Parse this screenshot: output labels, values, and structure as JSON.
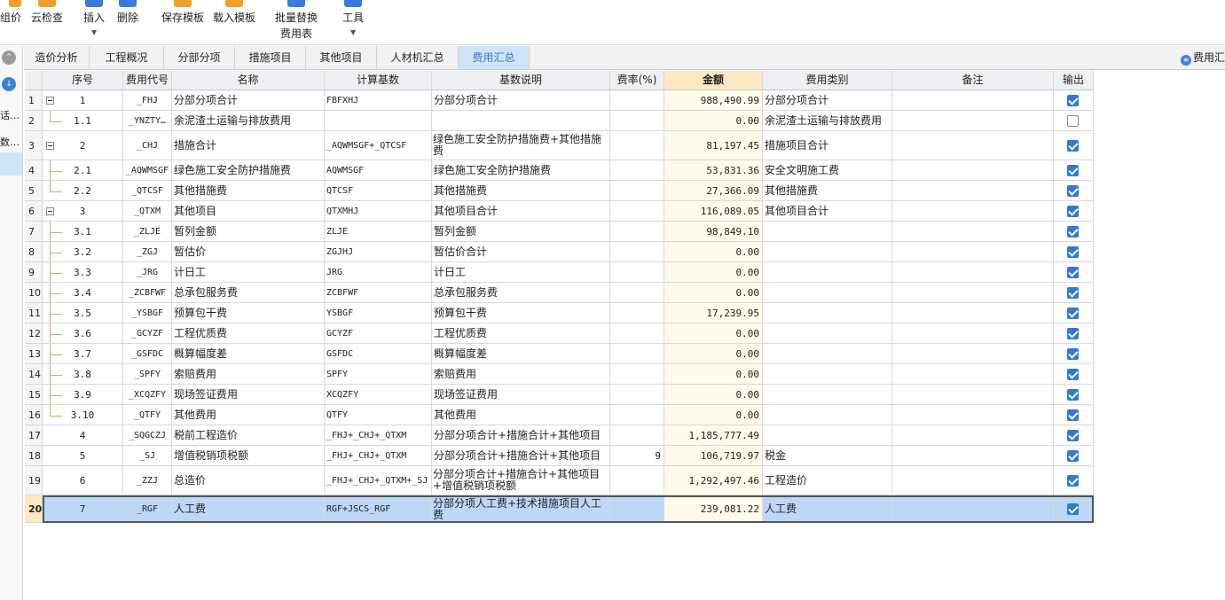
{
  "toolbar": {
    "buttons": [
      {
        "label": "组价",
        "label2": ""
      },
      {
        "label": "云检查",
        "label2": ""
      },
      {
        "label": "插入",
        "label2": ""
      },
      {
        "label": "删除",
        "label2": ""
      },
      {
        "label": "保存模板",
        "label2": ""
      },
      {
        "label": "载入模板",
        "label2": ""
      },
      {
        "label": "批量替换",
        "label2": "费用表"
      },
      {
        "label": "工具",
        "label2": ""
      }
    ]
  },
  "sidebar": {
    "items": [
      "话…",
      "数…"
    ]
  },
  "tabs": [
    "造价分析",
    "工程概况",
    "分部分项",
    "措施项目",
    "其他项目",
    "人材机汇总",
    "费用汇总"
  ],
  "active_tab": "费用汇总",
  "right_label": "费用汇",
  "columns": [
    "序号",
    "费用代号",
    "名称",
    "计算基数",
    "基数说明",
    "费率(%)",
    "金额",
    "费用类别",
    "备注",
    "输出"
  ],
  "rows": [
    {
      "rn": "1",
      "seq": "1",
      "code": "_FHJ",
      "name": "分部分项合计",
      "basis": "FBFXHJ",
      "desc": "分部分项合计",
      "rate": "",
      "amount": "988,490.99",
      "cat": "分部分项合计",
      "note": "",
      "out": true
    },
    {
      "rn": "2",
      "seq": "1.1",
      "code": "_YNZTY…",
      "name": "余泥渣土运输与排放费用",
      "basis": "",
      "desc": "",
      "rate": "",
      "amount": "0.00",
      "cat": "余泥渣土运输与排放费用",
      "note": "",
      "out": false
    },
    {
      "rn": "3",
      "seq": "2",
      "code": "_CHJ",
      "name": "措施合计",
      "basis": "_AQWMSGF+_QTCSF",
      "desc": "绿色施工安全防护措施费+其他措施费",
      "rate": "",
      "amount": "81,197.45",
      "cat": "措施项目合计",
      "note": "",
      "out": true
    },
    {
      "rn": "4",
      "seq": "2.1",
      "code": "_AQWMSGF",
      "name": "绿色施工安全防护措施费",
      "basis": "AQWMSGF",
      "desc": "绿色施工安全防护措施费",
      "rate": "",
      "amount": "53,831.36",
      "cat": "安全文明施工费",
      "note": "",
      "out": true
    },
    {
      "rn": "5",
      "seq": "2.2",
      "code": "_QTCSF",
      "name": "其他措施费",
      "basis": "QTCSF",
      "desc": "其他措施费",
      "rate": "",
      "amount": "27,366.09",
      "cat": "其他措施费",
      "note": "",
      "out": true
    },
    {
      "rn": "6",
      "seq": "3",
      "code": "_QTXM",
      "name": "其他项目",
      "basis": "QTXMHJ",
      "desc": "其他项目合计",
      "rate": "",
      "amount": "116,089.05",
      "cat": "其他项目合计",
      "note": "",
      "out": true
    },
    {
      "rn": "7",
      "seq": "3.1",
      "code": "_ZLJE",
      "name": "暂列金额",
      "basis": "ZLJE",
      "desc": "暂列金额",
      "rate": "",
      "amount": "98,849.10",
      "cat": "",
      "note": "",
      "out": true
    },
    {
      "rn": "8",
      "seq": "3.2",
      "code": "_ZGJ",
      "name": "暂估价",
      "basis": "ZGJHJ",
      "desc": "暂估价合计",
      "rate": "",
      "amount": "0.00",
      "cat": "",
      "note": "",
      "out": true
    },
    {
      "rn": "9",
      "seq": "3.3",
      "code": "_JRG",
      "name": "计日工",
      "basis": "JRG",
      "desc": "计日工",
      "rate": "",
      "amount": "0.00",
      "cat": "",
      "note": "",
      "out": true
    },
    {
      "rn": "10",
      "seq": "3.4",
      "code": "_ZCBFWF",
      "name": "总承包服务费",
      "basis": "ZCBFWF",
      "desc": "总承包服务费",
      "rate": "",
      "amount": "0.00",
      "cat": "",
      "note": "",
      "out": true
    },
    {
      "rn": "11",
      "seq": "3.5",
      "code": "_YSBGF",
      "name": "预算包干费",
      "basis": "YSBGF",
      "desc": "预算包干费",
      "rate": "",
      "amount": "17,239.95",
      "cat": "",
      "note": "",
      "out": true
    },
    {
      "rn": "12",
      "seq": "3.6",
      "code": "_GCYZF",
      "name": "工程优质费",
      "basis": "GCYZF",
      "desc": "工程优质费",
      "rate": "",
      "amount": "0.00",
      "cat": "",
      "note": "",
      "out": true
    },
    {
      "rn": "13",
      "seq": "3.7",
      "code": "_GSFDC",
      "name": "概算幅度差",
      "basis": "GSFDC",
      "desc": "概算幅度差",
      "rate": "",
      "amount": "0.00",
      "cat": "",
      "note": "",
      "out": true
    },
    {
      "rn": "14",
      "seq": "3.8",
      "code": "_SPFY",
      "name": "索赔费用",
      "basis": "SPFY",
      "desc": "索赔费用",
      "rate": "",
      "amount": "0.00",
      "cat": "",
      "note": "",
      "out": true
    },
    {
      "rn": "15",
      "seq": "3.9",
      "code": "_XCQZFY",
      "name": "现场签证费用",
      "basis": "XCQZFY",
      "desc": "现场签证费用",
      "rate": "",
      "amount": "0.00",
      "cat": "",
      "note": "",
      "out": true
    },
    {
      "rn": "16",
      "seq": "3.10",
      "code": "_QTFY",
      "name": "其他费用",
      "basis": "QTFY",
      "desc": "其他费用",
      "rate": "",
      "amount": "0.00",
      "cat": "",
      "note": "",
      "out": true
    },
    {
      "rn": "17",
      "seq": "4",
      "code": "_SQGCZJ",
      "name": "税前工程造价",
      "basis": "_FHJ+_CHJ+_QTXM",
      "desc": "分部分项合计+措施合计+其他项目",
      "rate": "",
      "amount": "1,185,777.49",
      "cat": "",
      "note": "",
      "out": true
    },
    {
      "rn": "18",
      "seq": "5",
      "code": "_SJ",
      "name": "增值税销项税额",
      "basis": "_FHJ+_CHJ+_QTXM",
      "desc": "分部分项合计+措施合计+其他项目",
      "rate": "9",
      "amount": "106,719.97",
      "cat": "税金",
      "note": "",
      "out": true
    },
    {
      "rn": "19",
      "seq": "6",
      "code": "_ZZJ",
      "name": "总造价",
      "basis": "_FHJ+_CHJ+_QTXM+_SJ",
      "desc": "分部分项合计+措施合计+其他项目+增值税销项税额",
      "rate": "",
      "amount": "1,292,497.46",
      "cat": "工程造价",
      "note": "",
      "out": true
    },
    {
      "rn": "20",
      "seq": "7",
      "code": "_RGF",
      "name": "人工费",
      "basis": "RGF+JSCS_RGF",
      "desc": "分部分项人工费+技术措施项目人工费",
      "rate": "",
      "amount": "239,081.22",
      "cat": "人工费",
      "note": "",
      "out": true
    }
  ],
  "colors": {
    "accent": "#2f7ad8",
    "selected_row": "#bcd8f6",
    "amount_col": "#fffbea",
    "amount_header": "#fde8c4",
    "tree_line": "#d4a95a"
  }
}
